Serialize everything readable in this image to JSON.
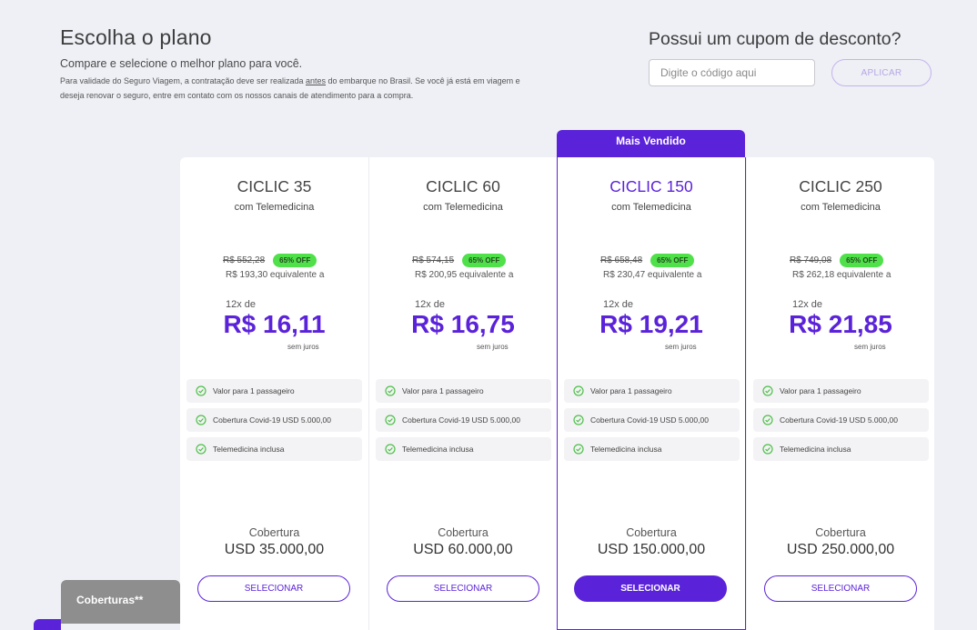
{
  "header": {
    "title": "Escolha o plano",
    "subtitle": "Compare e selecione o melhor plano para você.",
    "note_before": "Para validade do Seguro Viagem, a contratação deve ser realizada ",
    "note_emphasis": "antes",
    "note_after": " do embarque no Brasil. Se você já está em viagem e deseja renovar o seguro, entre em contato com os nossos canais de atendimento para a compra."
  },
  "coupon": {
    "title": "Possui um cupom de desconto?",
    "placeholder": "Digite o código aqui",
    "button_label": "APLICAR"
  },
  "badge": "Mais Vendido",
  "plans": [
    {
      "name": "CICLIC 35",
      "subtitle": "com Telemedicina",
      "old_price": "R$ 552,28",
      "discount": "65% OFF",
      "equivalent": "R$ 193,30 equivalente a",
      "installments": "12x de",
      "price": "R$ 16,11",
      "no_interest": "sem juros",
      "features": [
        "Valor para 1 passageiro",
        "Cobertura Covid-19 USD 5.000,00",
        "Telemedicina inclusa"
      ],
      "coverage_label": "Cobertura",
      "coverage_value": "USD 35.000,00",
      "button": "SELECIONAR"
    },
    {
      "name": "CICLIC 60",
      "subtitle": "com Telemedicina",
      "old_price": "R$ 574,15",
      "discount": "65% OFF",
      "equivalent": "R$ 200,95 equivalente a",
      "installments": "12x de",
      "price": "R$ 16,75",
      "no_interest": "sem juros",
      "features": [
        "Valor para 1 passageiro",
        "Cobertura Covid-19 USD 5.000,00",
        "Telemedicina inclusa"
      ],
      "coverage_label": "Cobertura",
      "coverage_value": "USD 60.000,00",
      "button": "SELECIONAR"
    },
    {
      "name": "CICLIC 150",
      "subtitle": "com Telemedicina",
      "old_price": "R$ 658,48",
      "discount": "65% OFF",
      "equivalent": "R$ 230,47 equivalente a",
      "installments": "12x de",
      "price": "R$ 19,21",
      "no_interest": "sem juros",
      "features": [
        "Valor para 1 passageiro",
        "Cobertura Covid-19 USD 5.000,00",
        "Telemedicina inclusa"
      ],
      "coverage_label": "Cobertura",
      "coverage_value": "USD 150.000,00",
      "button": "SELECIONAR"
    },
    {
      "name": "CICLIC 250",
      "subtitle": "com Telemedicina",
      "old_price": "R$ 749,08",
      "discount": "65% OFF",
      "equivalent": "R$ 262,18 equivalente a",
      "installments": "12x de",
      "price": "R$ 21,85",
      "no_interest": "sem juros",
      "features": [
        "Valor para 1 passageiro",
        "Cobertura Covid-19 USD 5.000,00",
        "Telemedicina inclusa"
      ],
      "coverage_label": "Cobertura",
      "coverage_value": "USD 250.000,00",
      "button": "SELECIONAR"
    }
  ],
  "coberturas_tab": "Coberturas**",
  "colors": {
    "accent": "#5b23d9",
    "discount_badge": "#4fe04a",
    "check": "#4fbf4a"
  }
}
